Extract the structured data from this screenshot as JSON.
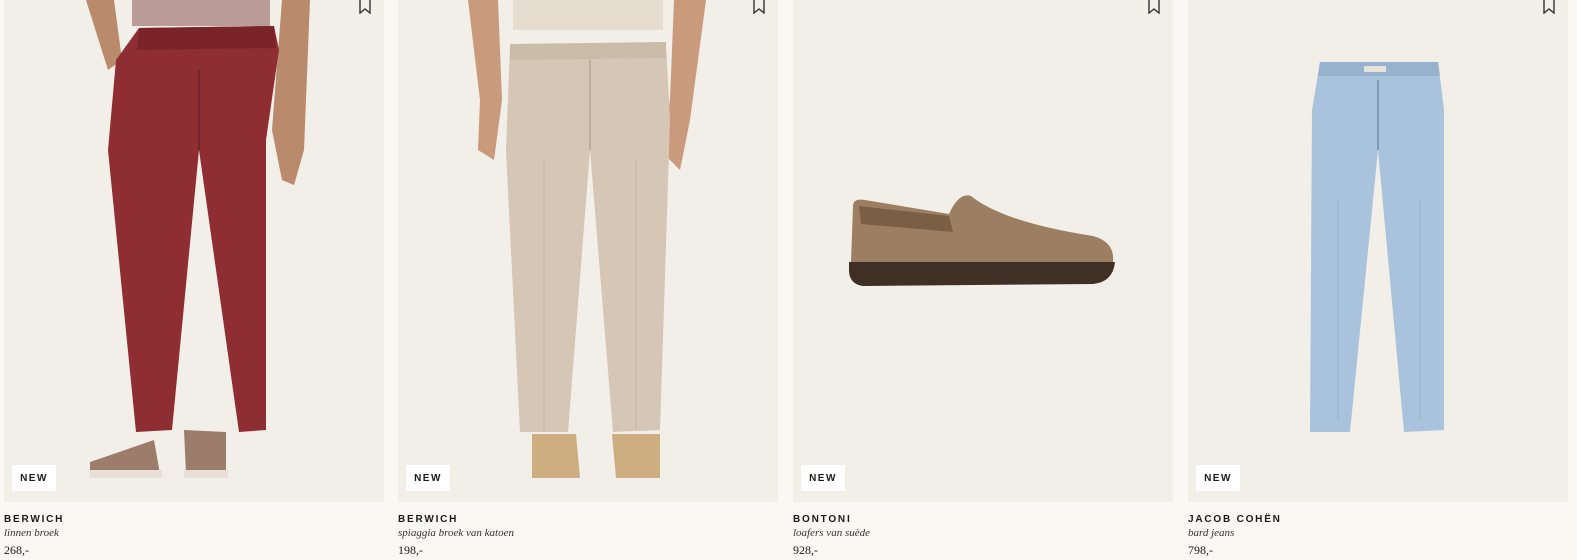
{
  "products": [
    {
      "brand": "BERWICH",
      "name": "linnen broek",
      "price": "268,-",
      "badge": "NEW",
      "image": "red-linen-trousers"
    },
    {
      "brand": "BERWICH",
      "name": "spiaggia broek van katoen",
      "price": "198,-",
      "badge": "NEW",
      "image": "beige-cotton-trousers"
    },
    {
      "brand": "BONTONI",
      "name": "loafers van suède",
      "price": "928,-",
      "badge": "NEW",
      "image": "brown-suede-loafer"
    },
    {
      "brand": "JACOB COHËN",
      "name": "bard jeans",
      "price": "798,-",
      "badge": "NEW",
      "image": "light-blue-jeans"
    }
  ],
  "icons": {
    "wishlist": "bookmark-icon"
  },
  "colors": {
    "background": "#fbf8f3",
    "tile": "#f2eee8",
    "badge_bg": "#ffffff"
  }
}
